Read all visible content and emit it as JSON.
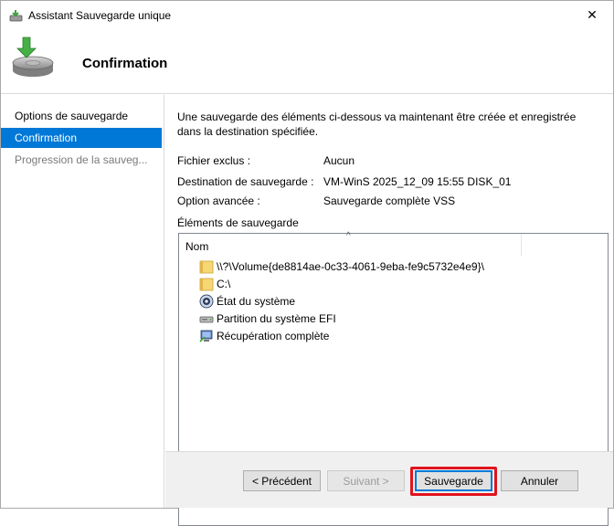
{
  "window": {
    "title": "Assistant Sauvegarde unique",
    "close_glyph": "✕"
  },
  "header": {
    "title": "Confirmation",
    "icon": "backup-disk-icon"
  },
  "sidebar": {
    "items": [
      {
        "label": "Options de sauvegarde",
        "state": "normal"
      },
      {
        "label": "Confirmation",
        "state": "active"
      },
      {
        "label": "Progression de la sauveg...",
        "state": "disabled"
      }
    ]
  },
  "main": {
    "intro": "Une sauvegarde des éléments ci-dessous va maintenant être créée et enregistrée dans la destination spécifiée.",
    "details": [
      {
        "label": "Fichier exclus :",
        "value": "Aucun"
      },
      {
        "label": "Destination de sauvegarde :",
        "value": "VM-WinS 2025_12_09 15:55 DISK_01"
      },
      {
        "label": "Option avancée :",
        "value": "Sauvegarde complète VSS"
      }
    ],
    "elements_label": "Éléments de sauvegarde",
    "list": {
      "column_header": "Nom",
      "sort_glyph": "^",
      "items": [
        {
          "label": "\\\\?\\Volume{de8814ae-0c33-4061-9eba-fe9c5732e4e9}\\",
          "icon": "folder-icon"
        },
        {
          "label": "C:\\",
          "icon": "folder-icon"
        },
        {
          "label": "État du système",
          "icon": "system-state-icon"
        },
        {
          "label": "Partition du système EFI",
          "icon": "drive-icon"
        },
        {
          "label": "Récupération complète",
          "icon": "recovery-icon"
        }
      ]
    }
  },
  "footer": {
    "previous_label": "< Précédent",
    "next_label": "Suivant >",
    "backup_label": "Sauvegarde",
    "cancel_label": "Annuler"
  },
  "colors": {
    "accent": "#0078d7",
    "highlight": "#e0141e"
  }
}
